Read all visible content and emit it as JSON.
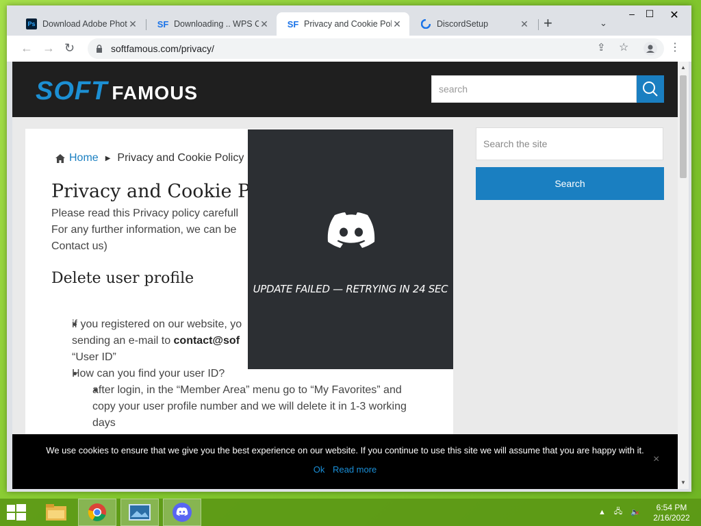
{
  "tabs": [
    {
      "title": "Download Adobe Photo",
      "icon": "photoshop-icon",
      "favicon_text": "Ps"
    },
    {
      "title": "Downloading .. WPS Of",
      "icon": "softfamous-icon",
      "favicon_text": "SF"
    },
    {
      "title": "Privacy and Cookie Poli",
      "icon": "softfamous-icon",
      "favicon_text": "SF",
      "active": true
    },
    {
      "title": "DiscordSetup",
      "icon": "discord-icon"
    }
  ],
  "toolbar": {
    "url": "softfamous.com/privacy/"
  },
  "site": {
    "logo_soft": "SOFT",
    "logo_famous": "FAMOUS",
    "header_search_placeholder": "search"
  },
  "article": {
    "breadcrumb": {
      "home": "Home",
      "current": "Privacy and Cookie Policy"
    },
    "title": "Privacy and Cookie Po",
    "intro_line1": "Please read this Privacy policy carefull",
    "intro_line2": "For any further information, we can be",
    "intro_line3": "Contact us)",
    "h_delete": "Delete user profile",
    "li1_line1": "if you registered on our website, yo",
    "li1_line2_prefix": "sending an e-mail to ",
    "li1_line2_bold": "contact@sof",
    "li1_line3": "“User ID”",
    "li2": "How can you find your user ID?",
    "li3_line1": "after login, in the “Member Area” menu go to “My Favorites” and",
    "li3_line2": "copy your user profile number and we will delete it in 1-3 working",
    "li3_line3": "days"
  },
  "sidebar": {
    "search_placeholder": "Search the site",
    "search_button": "Search"
  },
  "cookie": {
    "text": "We use cookies to ensure that we give you the best experience on our website. If you continue to use this site we will assume that you are happy with it.",
    "ok": "Ok",
    "read_more": "Read more",
    "close": "×"
  },
  "discord": {
    "status": "UPDATE FAILED — RETRYING IN 24 SEC"
  },
  "taskbar": {
    "time": "6:54 PM",
    "date": "2/16/2022",
    "apps": [
      "file-explorer-icon",
      "chrome-icon",
      "photos-icon",
      "discord-icon"
    ]
  }
}
